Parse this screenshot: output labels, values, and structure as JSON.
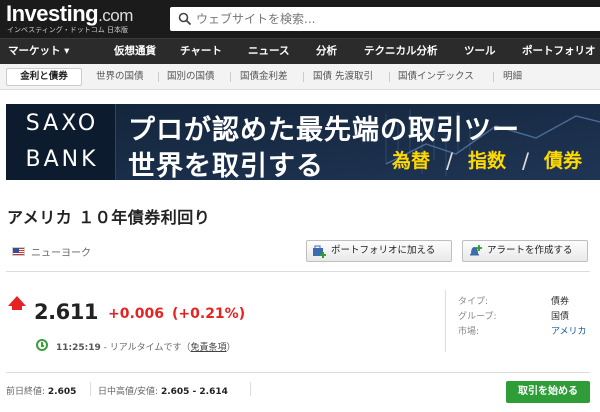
{
  "header": {
    "logo_main": "Investing",
    "logo_com": ".com",
    "logo_sub": "インベスティング・ドットコム 日本版",
    "search_placeholder": "ウェブサイトを検索..."
  },
  "nav": {
    "items": [
      "マーケット ▾",
      "仮想通貨",
      "チャート",
      "ニュース",
      "分析",
      "テクニカル分析",
      "ツール",
      "ポートフォリオ"
    ]
  },
  "subnav": {
    "items": [
      "金利と債券",
      "世界の国債",
      "国別の国債",
      "国債金利差",
      "国債 先渡取引",
      "国債インデックス",
      "明細"
    ]
  },
  "banner": {
    "brand_line1": "SAXO",
    "brand_line2": "BANK",
    "headline1": "プロが認めた最先端の取引ツー",
    "headline2": "世界を取引する",
    "tags": [
      "為替",
      "指数",
      "債券"
    ]
  },
  "instrument": {
    "title": "アメリカ １０年債券利回り",
    "exchange": "ニューヨーク",
    "add_portfolio_label": "ポートフォリオに加える",
    "create_alert_label": "アラートを作成する",
    "price": "2.611",
    "change": "+0.006",
    "change_pct": "(+0.21%)",
    "time": "11:25:19",
    "time_note": " - リアルタイムです（",
    "disclaimer": "免責条項",
    "time_close": "）",
    "info": [
      {
        "label": "タイプ:",
        "value": "債券"
      },
      {
        "label": "グループ:",
        "value": "国債"
      },
      {
        "label": "市場:",
        "value": "アメリカ"
      }
    ],
    "prev_close_label": "前日終値: ",
    "prev_close": "2.605",
    "day_range_label": "日中高値/安値: ",
    "day_range": "2.605 - 2.614",
    "trade_button": "取引を始める"
  },
  "colors": {
    "up": "#e62222",
    "trade_green": "#2e9c37",
    "topbar": "#1b1b1b"
  }
}
